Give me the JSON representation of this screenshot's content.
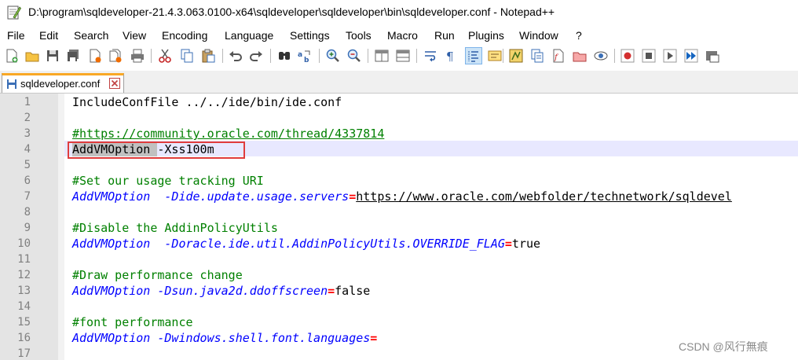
{
  "window": {
    "title": "D:\\program\\sqldeveloper-21.4.3.063.0100-x64\\sqldeveloper\\sqldeveloper\\bin\\sqldeveloper.conf - Notepad++"
  },
  "menu": [
    "File",
    "Edit",
    "Search",
    "View",
    "Encoding",
    "Language",
    "Settings",
    "Tools",
    "Macro",
    "Run",
    "Plugins",
    "Window",
    "?"
  ],
  "tab": {
    "label": "sqldeveloper.conf"
  },
  "editor": {
    "line_numbers": [
      "1",
      "2",
      "3",
      "4",
      "5",
      "6",
      "7",
      "8",
      "9",
      "10",
      "11",
      "12",
      "13",
      "14",
      "15",
      "16",
      "17"
    ],
    "lines": {
      "l1": "IncludeConfFile ../../ide/bin/ide.conf",
      "l3": "#https://community.oracle.com/thread/4337814",
      "l4_sel": "AddVMOption ",
      "l4_rest": "-Xss100m",
      "l6": "#Set our usage tracking URI",
      "l7_key": "AddVMOption  -Dide.update.usage.servers",
      "l7_eq": "=",
      "l7_val": "https://www.oracle.com/webfolder/technetwork/sqldevel",
      "l9": "#Disable the AddinPolicyUtils",
      "l10_key": "AddVMOption  -Doracle.ide.util.AddinPolicyUtils.OVERRIDE_FLAG",
      "l10_eq": "=",
      "l10_val": "true",
      "l12": "#Draw performance change",
      "l13_key": "AddVMOption -Dsun.java2d.ddoffscreen",
      "l13_eq": "=",
      "l13_val": "false",
      "l15": "#font performance",
      "l16_key": "AddVMOption -Dwindows.shell.font.languages",
      "l16_eq": "="
    }
  },
  "watermark": "CSDN @风行無痕",
  "colors": {
    "comment": "#008000",
    "keyword": "#0000ff",
    "operator": "#ff0000",
    "gutter": "#e4e4e4",
    "highlight_box": "#e03c3c",
    "tab_accent": "#f9a825"
  }
}
